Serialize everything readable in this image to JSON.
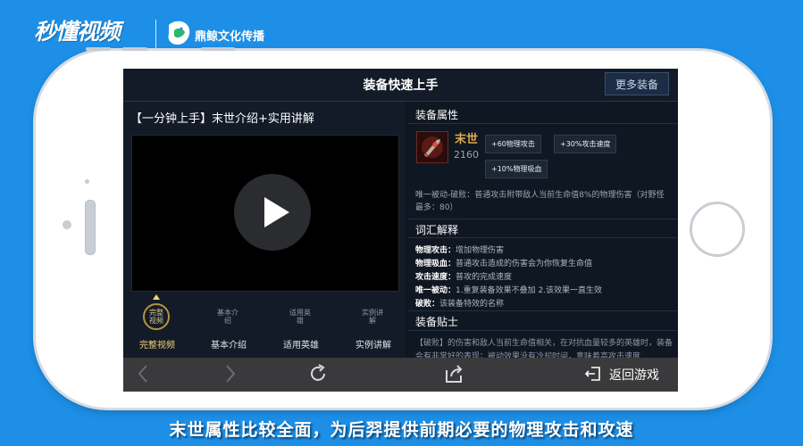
{
  "brand": {
    "logo_text": "秒懂视频",
    "partner_name": "鼎鲸文化传播"
  },
  "header": {
    "title": "装备快速上手",
    "more_button": "更多装备"
  },
  "video": {
    "title": "【一分钟上手】末世介绍+实用讲解",
    "tabs": [
      {
        "icon_text": "完整视频",
        "label": "完整视频",
        "active": true
      },
      {
        "icon_text": "基本介绍",
        "label": "基本介绍",
        "active": false
      },
      {
        "icon_text": "适用英雄",
        "label": "适用英雄",
        "active": false
      },
      {
        "icon_text": "实例讲解",
        "label": "实例讲解",
        "active": false
      }
    ]
  },
  "item": {
    "section_title": "装备属性",
    "name": "末世",
    "price": "2160",
    "stats": [
      "+60物理攻击",
      "+30%攻击速度",
      "+10%物理吸血"
    ],
    "passive": "唯一被动-破败：普通攻击附带敌人当前生命值8%的物理伤害（对野怪最多：80）"
  },
  "glossary": {
    "section_title": "词汇解释",
    "entries": [
      {
        "term": "物理攻击：",
        "desc": "增加物理伤害"
      },
      {
        "term": "物理吸血：",
        "desc": "普通攻击造成的伤害会为你恢复生命值"
      },
      {
        "term": "攻击速度：",
        "desc": "普攻的完成速度"
      },
      {
        "term": "唯一被动：",
        "desc": "1.重复装备效果不叠加 2.该效果一直生效"
      },
      {
        "term": "破败：",
        "desc": "该装备特效的名称"
      }
    ]
  },
  "tips": {
    "section_title": "装备贴士",
    "text": "【破败】的伤害和敌人当前生命值相关，在对抗血量较多的英雄时，装备会有非常好的表现；被动效果没有冷却时间，意味着高攻击速度"
  },
  "bottom_bar": {
    "back_game": "返回游戏"
  },
  "subtitle": "末世属性比较全面，为后羿提供前期必要的物理攻击和攻速",
  "colors": {
    "background": "#1d8fe6",
    "accent_gold": "#f0cf73",
    "item_name": "#e0aa4c",
    "screen_bg": "#0c1119"
  }
}
